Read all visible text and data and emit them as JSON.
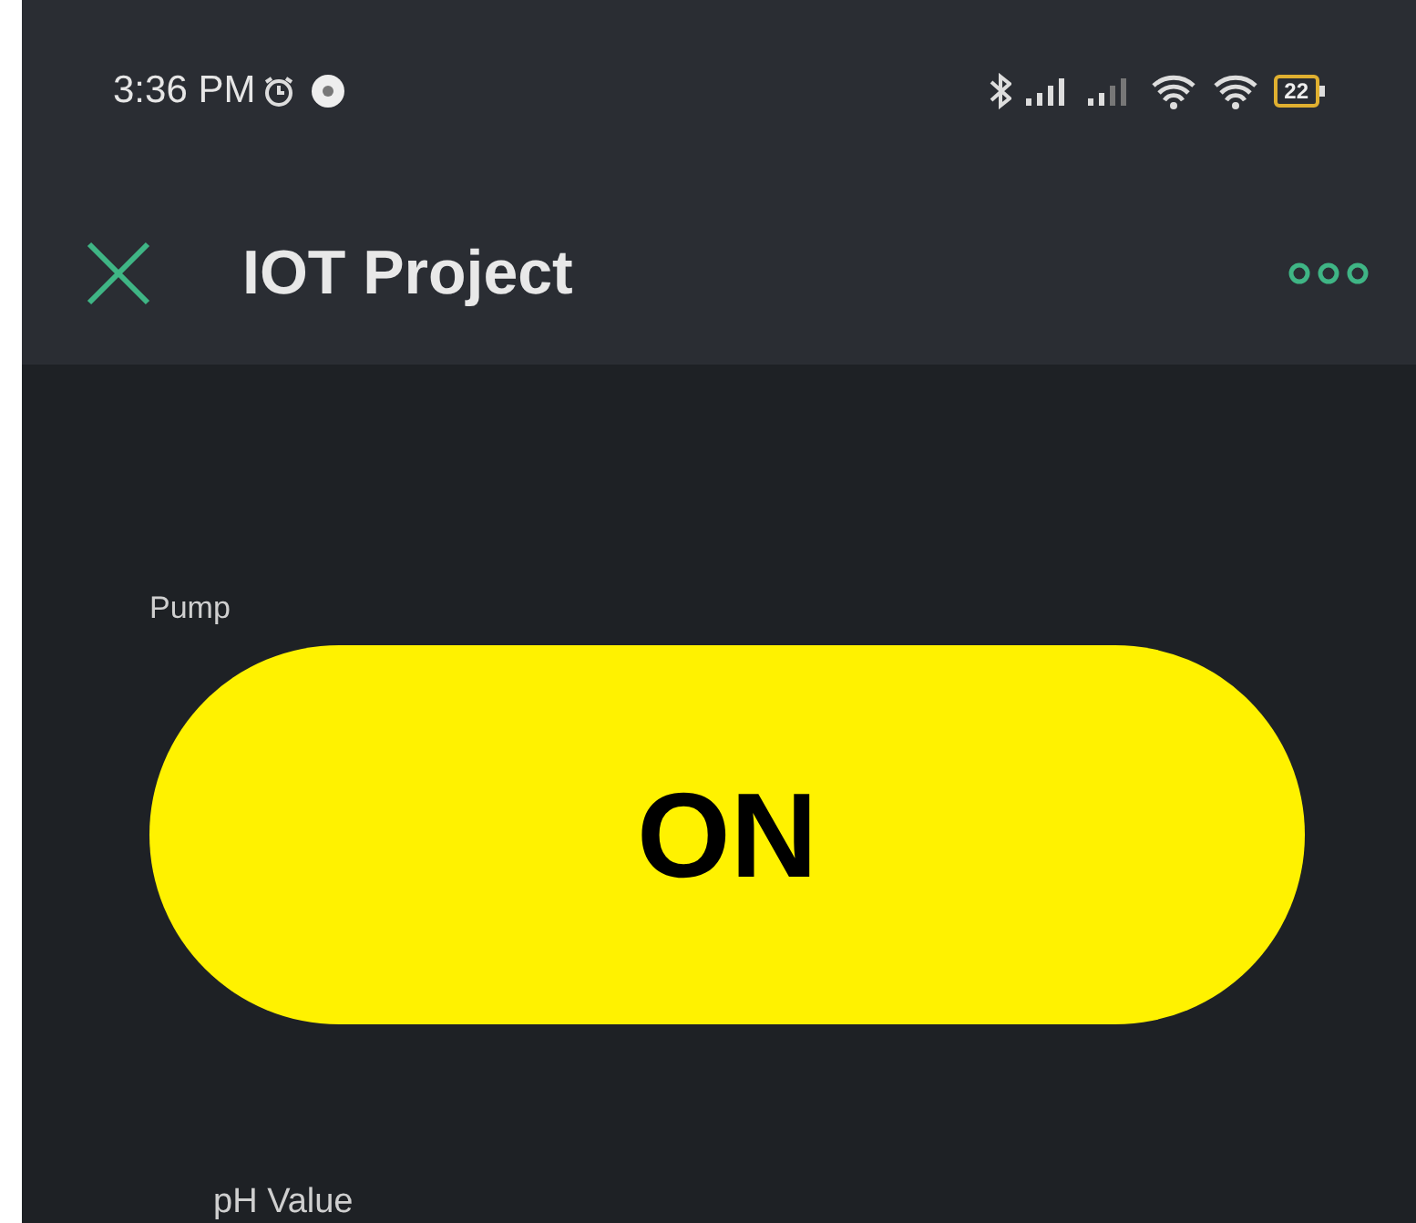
{
  "status_bar": {
    "time": "3:36 PM",
    "battery": "22"
  },
  "header": {
    "title": "IOT Project"
  },
  "widgets": [
    {
      "kind": "switch",
      "label": "Pump",
      "on": true,
      "text": "ON"
    },
    {
      "kind": "value",
      "label": "pH Value"
    }
  ]
}
